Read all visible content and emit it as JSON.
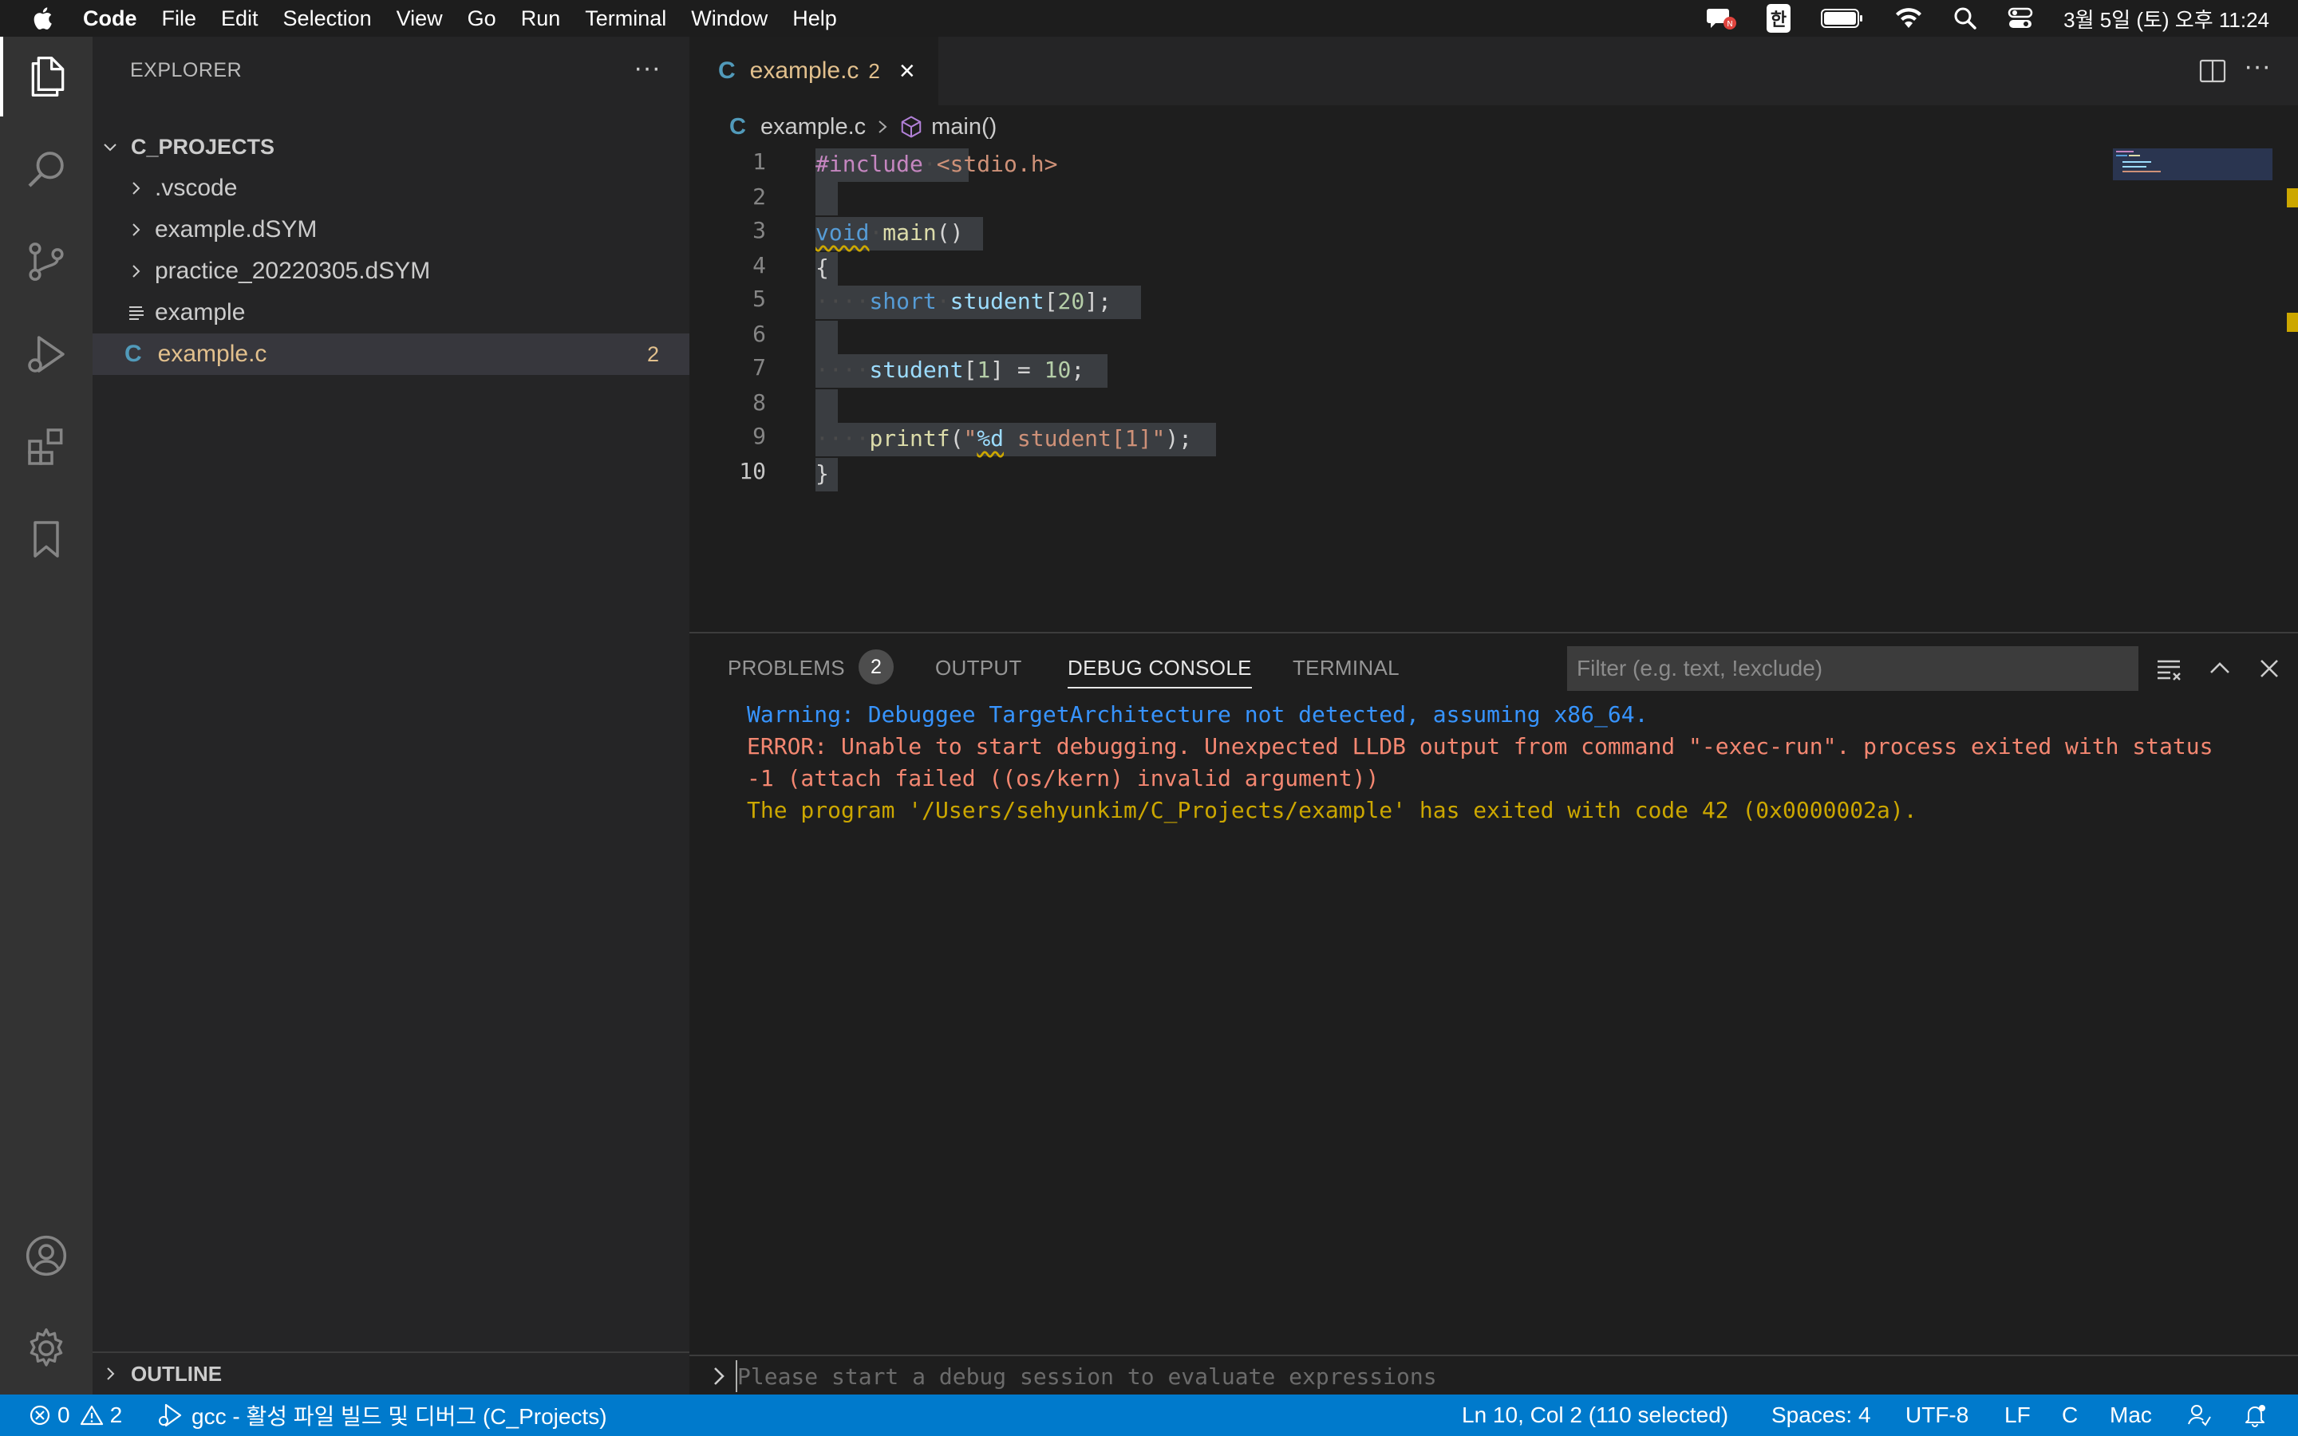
{
  "menubar": {
    "app_name": "Code",
    "items": [
      "File",
      "Edit",
      "Selection",
      "View",
      "Go",
      "Run",
      "Terminal",
      "Window",
      "Help"
    ],
    "input_method": "한",
    "datetime": "3월 5일 (토) 오후 11:24"
  },
  "sidebar": {
    "title": "EXPLORER",
    "more_label": "···",
    "folder": "C_PROJECTS",
    "items": [
      {
        "label": ".vscode",
        "type": "folder"
      },
      {
        "label": "example.dSYM",
        "type": "folder"
      },
      {
        "label": "practice_20220305.dSYM",
        "type": "folder"
      },
      {
        "label": "example",
        "type": "file"
      },
      {
        "label": "example.c",
        "type": "c-file",
        "problems": "2"
      }
    ],
    "outline_label": "OUTLINE",
    "c_icon": "C"
  },
  "editor": {
    "tab": {
      "icon": "C",
      "name": "example.c",
      "problems": "2",
      "close": "×"
    },
    "more_label": "···",
    "breadcrumb": {
      "file": "example.c",
      "symbol": "main()"
    },
    "line_numbers": [
      "1",
      "2",
      "3",
      "4",
      "5",
      "6",
      "7",
      "8",
      "9",
      "10"
    ],
    "code": {
      "l1_directive": "#include",
      "l1_header": "<stdio.h>",
      "l3_type": "void",
      "l3_fn": "main",
      "l3_rest": "()",
      "l4": "{",
      "l5_type": "short",
      "l5_var": "student",
      "l5_rest": "[",
      "l5_num": "20",
      "l5_end": "];",
      "l7_var": "student",
      "l7_idx_open": "[",
      "l7_idx": "1",
      "l7_mid": "] = ",
      "l7_num": "10",
      "l7_end": ";",
      "l9_fn": "printf",
      "l9_open": "(",
      "l9_q": "\"",
      "l9_fmt": "%d",
      "l9_str": " student[1]\"",
      "l9_end": ");",
      "l10": "}",
      "indent": "···"
    }
  },
  "panel": {
    "tabs": [
      {
        "label": "PROBLEMS",
        "badge": "2"
      },
      {
        "label": "OUTPUT"
      },
      {
        "label": "DEBUG CONSOLE"
      },
      {
        "label": "TERMINAL"
      }
    ],
    "active_tab": "DEBUG CONSOLE",
    "filter_placeholder": "Filter (e.g. text, !exclude)",
    "console": [
      {
        "kind": "warning",
        "text": "Warning: Debuggee TargetArchitecture not detected, assuming x86_64."
      },
      {
        "kind": "error",
        "text": "ERROR: Unable to start debugging. Unexpected LLDB output from command \"-exec-run\". process exited with status"
      },
      {
        "kind": "error",
        "text": "-1 (attach failed ((os/kern) invalid argument))"
      },
      {
        "kind": "info",
        "text": "The program '/Users/sehyunkim/C_Projects/example' has exited with code 42 (0x0000002a)."
      }
    ],
    "input_placeholder": "Please start a debug session to evaluate expressions"
  },
  "statusbar": {
    "errors": "0",
    "warnings": "2",
    "task": "gcc - 활성 파일 빌드 및 디버그 (C_Projects)",
    "cursor": "Ln 10, Col 2 (110 selected)",
    "spaces": "Spaces: 4",
    "encoding": "UTF-8",
    "eol": "LF",
    "language": "C",
    "platform": "Mac",
    "bg_color": "#007acc"
  }
}
